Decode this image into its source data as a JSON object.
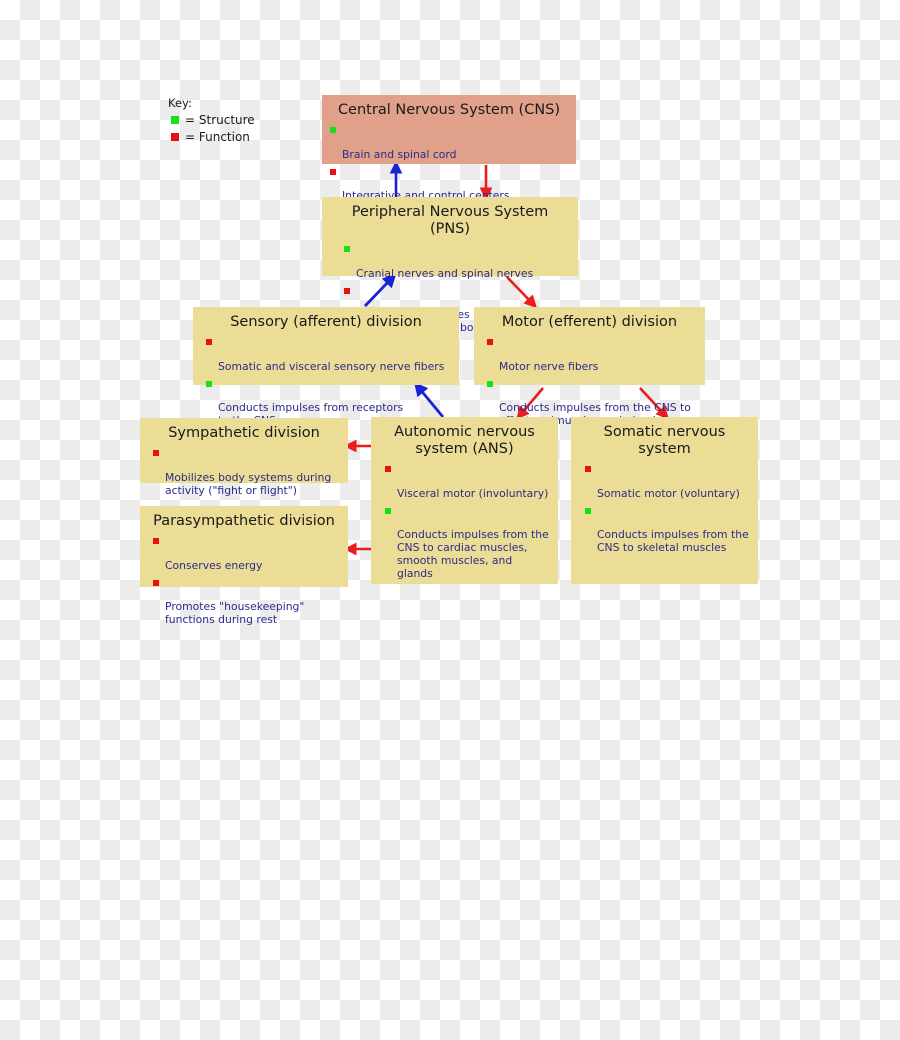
{
  "key": {
    "title": "Key:",
    "items": [
      {
        "marker": "green-square",
        "label": "= Structure"
      },
      {
        "marker": "red-square",
        "label": "= Function"
      }
    ]
  },
  "colors": {
    "cns_box": "#e0a089",
    "pns_box": "#ebdc96",
    "structure_marker": "#16e016",
    "function_marker": "#e81010",
    "bullet_text": "#2a2a8c",
    "title_text": "#1a1a1a",
    "arrow_blue": "#1a22d8",
    "arrow_red": "#ec1c1c",
    "background_checker": "#ececec"
  },
  "boxes": {
    "cns": {
      "title": "Central Nervous System (CNS)",
      "bullets": [
        {
          "type": "structure",
          "text": "Brain and spinal cord"
        },
        {
          "type": "function",
          "text": "Integrative and control centers"
        }
      ]
    },
    "pns": {
      "title": "Peripheral Nervous System (PNS)",
      "bullets": [
        {
          "type": "structure",
          "text": "Cranial nerves and spinal nerves"
        },
        {
          "type": "function",
          "text": "Communication lines between the CNS\nand the rest of the body"
        }
      ]
    },
    "sensory": {
      "title": "Sensory (afferent) division",
      "bullets": [
        {
          "type": "function",
          "text": "Somatic and visceral sensory nerve fibers"
        },
        {
          "type": "structure",
          "text": "Conducts impulses from receptors\nto the CNS"
        }
      ]
    },
    "motor": {
      "title": "Motor (efferent) division",
      "bullets": [
        {
          "type": "function",
          "text": "Motor nerve fibers"
        },
        {
          "type": "structure",
          "text": "Conducts impulses from the CNS to\neffectors (muscles and glands)"
        }
      ]
    },
    "sympathetic": {
      "title": "Sympathetic division",
      "bullets": [
        {
          "type": "function",
          "text": "Mobilizes body systems during\nactivity (\"fight or flight\")"
        }
      ]
    },
    "parasympathetic": {
      "title": "Parasympathetic division",
      "bullets": [
        {
          "type": "function",
          "text": "Conserves energy"
        },
        {
          "type": "function",
          "text": "Promotes \"housekeeping\"\nfunctions during rest"
        }
      ]
    },
    "ans": {
      "title": "Autonomic nervous\nsystem (ANS)",
      "bullets": [
        {
          "type": "function",
          "text": "Visceral motor (involuntary)"
        },
        {
          "type": "structure",
          "text": "Conducts impulses from the\nCNS to cardiac muscles,\nsmooth muscles, and glands"
        }
      ]
    },
    "somatic": {
      "title": "Somatic nervous\nsystem",
      "bullets": [
        {
          "type": "function",
          "text": "Somatic motor (voluntary)"
        },
        {
          "type": "structure",
          "text": "Conducts impulses from the\nCNS to skeletal muscles"
        }
      ]
    }
  },
  "arrows": [
    {
      "name": "pns-to-cns",
      "color": "blue"
    },
    {
      "name": "cns-to-pns",
      "color": "red"
    },
    {
      "name": "sensory-to-pns",
      "color": "blue"
    },
    {
      "name": "pns-to-motor",
      "color": "red"
    },
    {
      "name": "ans-to-motor",
      "color": "blue"
    },
    {
      "name": "motor-to-ans",
      "color": "red"
    },
    {
      "name": "motor-to-somatic",
      "color": "red"
    },
    {
      "name": "ans-to-sympathetic",
      "color": "red"
    },
    {
      "name": "ans-to-parasympathetic",
      "color": "red"
    }
  ]
}
